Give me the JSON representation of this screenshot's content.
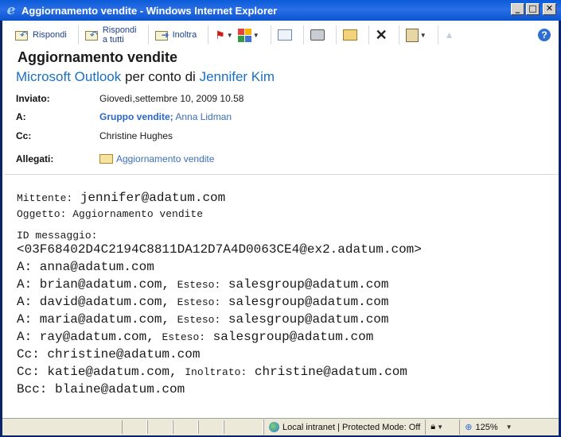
{
  "window": {
    "title": "Aggiornamento vendite - Windows Internet Explorer"
  },
  "toolbar": {
    "reply": "Rispondi",
    "reply_all_line1": "Rispondi",
    "reply_all_line2": "a tutti",
    "forward": "Inoltra"
  },
  "message": {
    "subject": "Aggiornamento vendite",
    "sender_app": "Microsoft Outlook",
    "on_behalf_text": "per conto di",
    "sender_name": "Jennifer Kim",
    "sent_label": "Inviato:",
    "sent_value": "Giovedì,settembre 10, 2009 10.58",
    "to_label": "A:",
    "to_group": "Gruppo vendite;",
    "to_person": "Anna Lidman",
    "cc_label": "Cc:",
    "cc_value": "Christine Hughes",
    "attach_label": "Allegati:",
    "attach_value": "Aggiornamento vendite"
  },
  "body": {
    "mittente_label": "Mittente:",
    "mittente_value": "jennifer@adatum.com",
    "oggetto": "Oggetto: Aggiornamento vendite",
    "id_label": "ID messaggio:",
    "id_value": "<03F68402D4C2194C8811DA12D7A4D0063CE4@ex2.adatum.com>",
    "lines": [
      {
        "prefix": "A: anna@adatum.com",
        "mid": "",
        "suffix": ""
      },
      {
        "prefix": "A: brian@adatum.com,",
        "mid": "Esteso:",
        "suffix": "salesgroup@adatum.com"
      },
      {
        "prefix": "A: david@adatum.com,",
        "mid": "Esteso:",
        "suffix": "salesgroup@adatum.com"
      },
      {
        "prefix": "A: maria@adatum.com,",
        "mid": "Esteso:",
        "suffix": "salesgroup@adatum.com"
      },
      {
        "prefix": "A: ray@adatum.com,",
        "mid": "Esteso:",
        "suffix": "salesgroup@adatum.com"
      },
      {
        "prefix": "Cc: christine@adatum.com",
        "mid": "",
        "suffix": ""
      },
      {
        "prefix": "Cc: katie@adatum.com,",
        "mid": "Inoltrato:",
        "suffix": "christine@adatum.com"
      },
      {
        "prefix": "Bcc: blaine@adatum.com",
        "mid": "",
        "suffix": ""
      }
    ]
  },
  "statusbar": {
    "zone": "Local intranet | Protected Mode: Off",
    "zoom": "125%"
  }
}
